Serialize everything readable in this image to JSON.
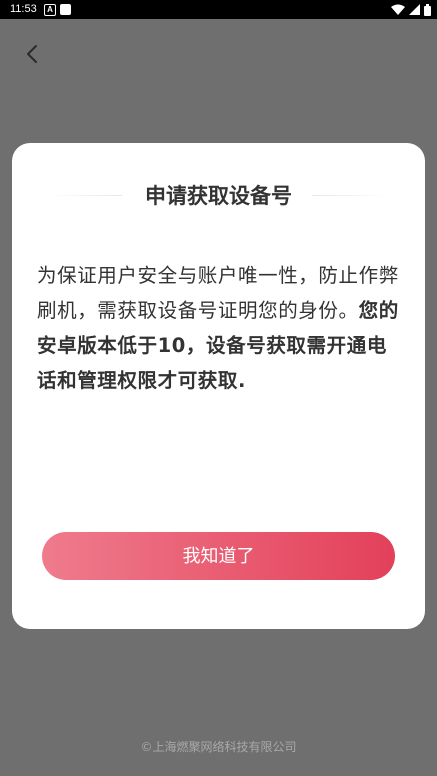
{
  "status_bar": {
    "time": "11:53",
    "notification_icon_letter": "A",
    "icons": [
      "a-notification-icon",
      "square-notification-icon",
      "wifi-icon",
      "cell-signal-icon",
      "battery-icon"
    ]
  },
  "nav": {
    "back_icon": "chevron-left-icon"
  },
  "dialog": {
    "title": "申请获取设备号",
    "body_normal": "为保证用户安全与账户唯一性，防止作弊刷机，需获取设备号证明您的身份。",
    "body_bold": "您的安卓版本低于10，设备号获取需开通电话和管理权限才可获取.",
    "confirm_label": "我知道了",
    "button_gradient": [
      "#ef7b8c",
      "#e3405a"
    ]
  },
  "footer": {
    "copyright": "©上海燃聚网络科技有限公司"
  }
}
